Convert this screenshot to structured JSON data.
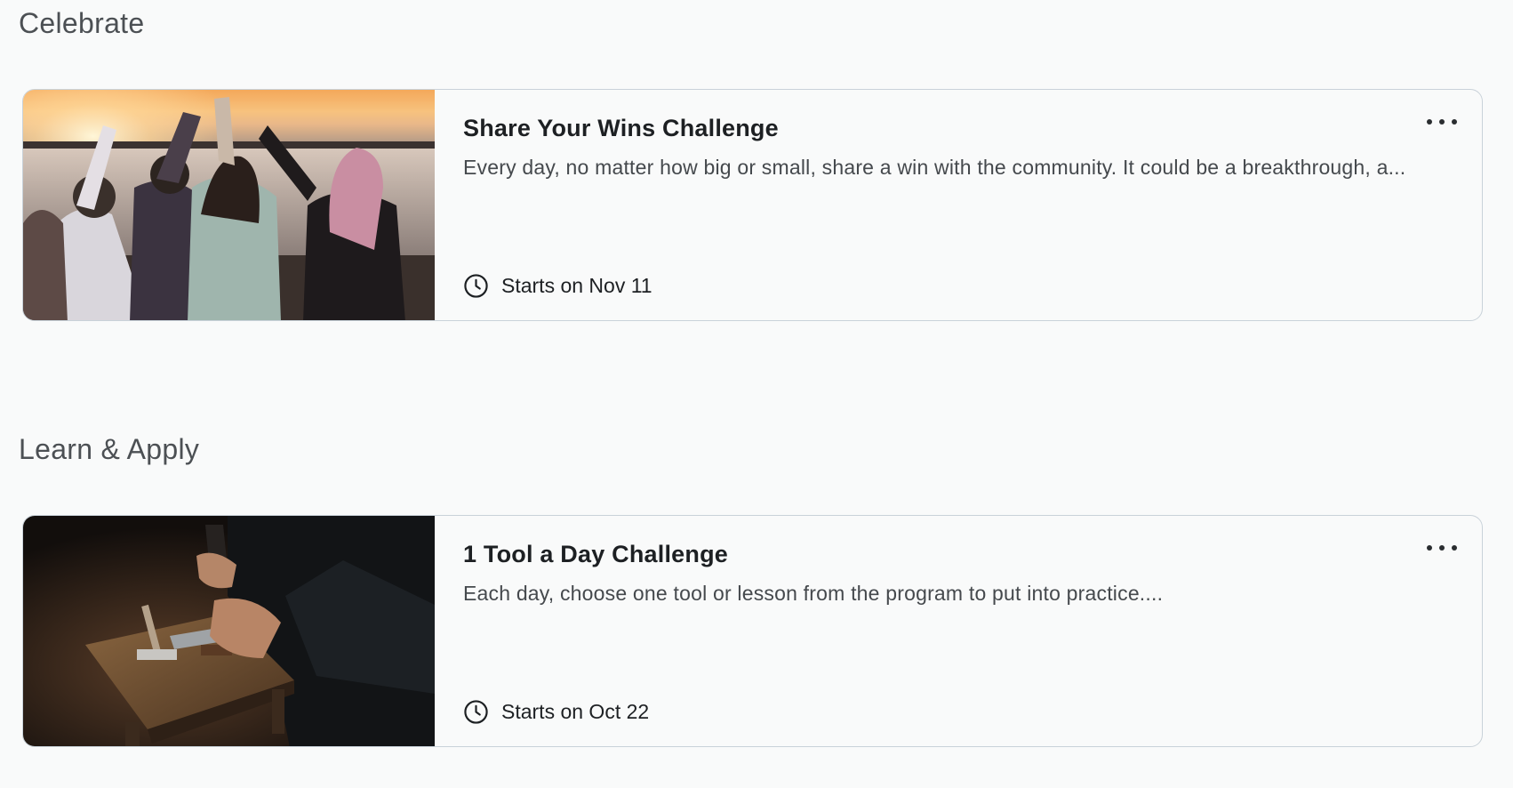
{
  "sections": [
    {
      "title": "Celebrate",
      "card": {
        "title": "Share Your Wins Challenge",
        "description": "Every day, no matter how big or small, share a win with the community. It could be a breakthrough, a...",
        "date_label": "Starts on Nov 11",
        "image": "sunset-friends-heart-hands-photo"
      }
    },
    {
      "title": "Learn & Apply",
      "card": {
        "title": "1 Tool a Day Challenge",
        "description": "Each day, choose one tool or lesson from the program to put into practice....",
        "date_label": "Starts on Oct 22",
        "image": "workbench-tools-hands-photo"
      }
    }
  ],
  "icons": {
    "clock": "clock-icon",
    "more": "more-options-icon"
  },
  "colors": {
    "background": "#f9fafa",
    "card_border": "#c9d2d9",
    "title_text": "#1d2023",
    "description_text": "#45494d"
  }
}
